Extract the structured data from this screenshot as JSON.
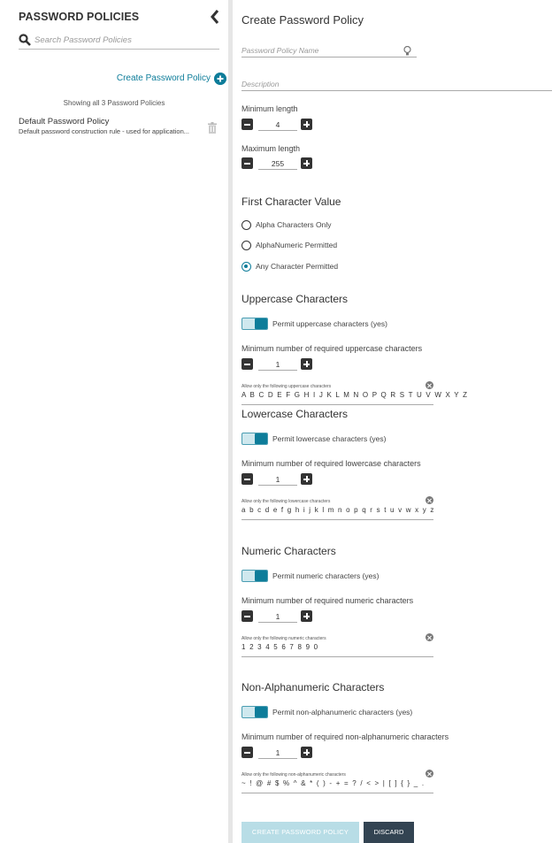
{
  "sidebar": {
    "title": "PASSWORD POLICIES",
    "search_placeholder": "Search Password Policies",
    "create_label": "Create Password Policy",
    "showing": "Showing all 3 Password Policies",
    "policies": [
      {
        "name": "Default Password Policy",
        "description": "Default password construction rule - used for application..."
      }
    ]
  },
  "main": {
    "title": "Create Password Policy",
    "name_placeholder": "Password Policy Name",
    "description_placeholder": "Description",
    "min_length_label": "Minimum length",
    "min_length_value": "4",
    "max_length_label": "Maximum length",
    "max_length_value": "255",
    "first_char": {
      "heading": "First Character Value",
      "options": [
        "Alpha Characters Only",
        "AlphaNumeric Permitted",
        "Any Character Permitted"
      ],
      "selected": "Any Character Permitted"
    },
    "uppercase": {
      "heading": "Uppercase Characters",
      "toggle_label": "Permit uppercase characters (yes)",
      "min_label": "Minimum number of required uppercase characters",
      "min_value": "1",
      "allow_label": "Allow only the following uppercase characters",
      "allow_value": "A B C D E F G H I J K L M N O P Q R S T U V W X Y Z"
    },
    "lowercase": {
      "heading": "Lowercase Characters",
      "toggle_label": "Permit lowercase characters (yes)",
      "min_label": "Minimum number of required lowercase characters",
      "min_value": "1",
      "allow_label": "Allow only the following lowercase characters",
      "allow_value": "a b c d e f g h i j k l m n o p q r s t u v w x y z"
    },
    "numeric": {
      "heading": "Numeric Characters",
      "toggle_label": "Permit numeric characters (yes)",
      "min_label": "Minimum number of required numeric characters",
      "min_value": "1",
      "allow_label": "Allow only the following numeric characters",
      "allow_value": "1 2 3 4 5 6 7 8 9 0"
    },
    "nonalpha": {
      "heading": "Non-Alphanumeric Characters",
      "toggle_label": "Permit non-alphanumeric characters (yes)",
      "min_label": "Minimum number of required non-alphanumeric characters",
      "min_value": "1",
      "allow_label": "Allow only the following non-alphanumeric characters",
      "allow_value": "~ ! @ # $ % ^ & * ( ) - + = ? / < > | [ ] { } _ ."
    },
    "create_button": "CREATE PASSWORD POLICY",
    "discard_button": "DISCARD"
  },
  "colors": {
    "accent": "#0e7d9a",
    "dark_button": "#334452",
    "disabled_button": "#b8dde6"
  }
}
